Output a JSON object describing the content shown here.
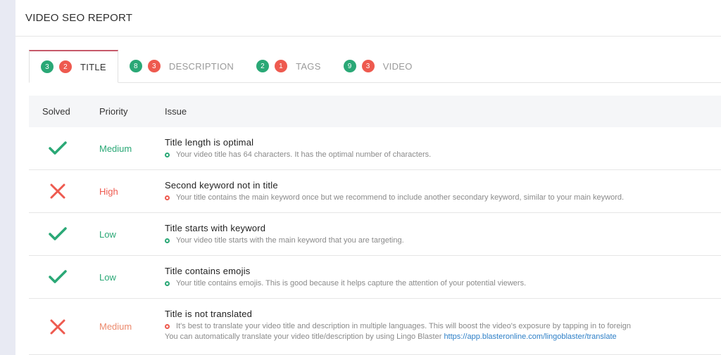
{
  "header": {
    "title": "VIDEO SEO REPORT"
  },
  "tabs": [
    {
      "label": "TITLE",
      "solved": "3",
      "issues": "2",
      "active": true
    },
    {
      "label": "DESCRIPTION",
      "solved": "8",
      "issues": "3",
      "active": false
    },
    {
      "label": "TAGS",
      "solved": "2",
      "issues": "1",
      "active": false
    },
    {
      "label": "VIDEO",
      "solved": "9",
      "issues": "3",
      "active": false
    }
  ],
  "table": {
    "headers": {
      "solved": "Solved",
      "priority": "Priority",
      "issue": "Issue"
    },
    "rows": [
      {
        "solved": true,
        "priority": "Medium",
        "title": "Title length is optimal",
        "desc": "Your video title has 64 characters. It has the optimal number of characters."
      },
      {
        "solved": false,
        "priority": "High",
        "title": "Second keyword not in title",
        "desc": "Your title contains the main keyword once but we recommend to include another secondary keyword, similar to your main keyword."
      },
      {
        "solved": true,
        "priority": "Low",
        "title": "Title starts with keyword",
        "desc": "Your video title starts with the main keyword that you are targeting."
      },
      {
        "solved": true,
        "priority": "Low",
        "title": "Title contains emojis",
        "desc": "Your title contains emojis. This is good because it helps capture the attention of your potential viewers."
      },
      {
        "solved": false,
        "priority": "Medium",
        "title": "Title is not translated",
        "desc": "It's best to translate your video title and description in multiple languages. This will boost the video's exposure by tapping in to foreign",
        "desc2": "You can automatically translate your video title/description by using Lingo Blaster",
        "link": "https://app.blasteronline.com/lingoblaster/translate"
      }
    ]
  },
  "colors": {
    "green": "#2aa876",
    "red": "#ee5a4f",
    "accent": "#c65a6a",
    "link": "#2d7fc7"
  }
}
